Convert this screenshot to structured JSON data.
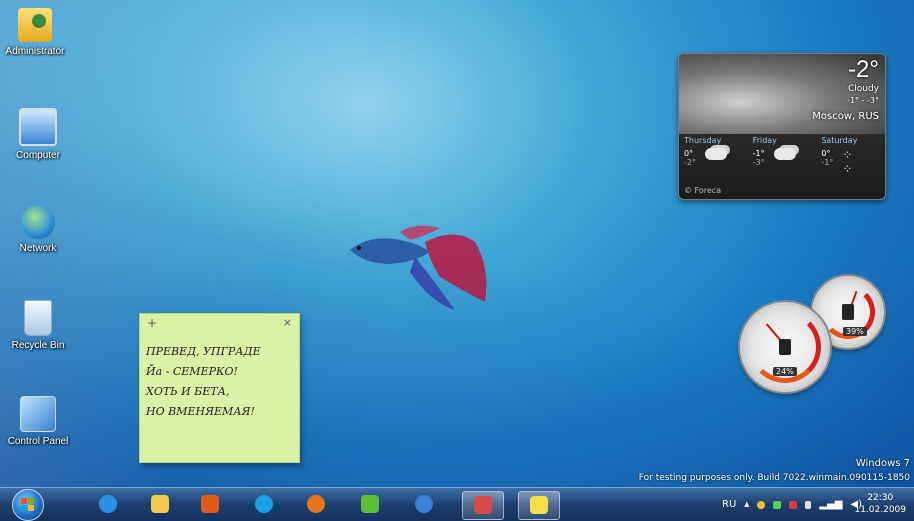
{
  "desktop": {
    "icons": [
      {
        "label": "Administrator"
      },
      {
        "label": "Computer"
      },
      {
        "label": "Network"
      },
      {
        "label": "Recycle Bin"
      },
      {
        "label": "Control Panel"
      }
    ],
    "watermark": {
      "line1": "Windows 7",
      "line2": "For testing purposes only. Build 7022.winmain.090115-1850"
    }
  },
  "weather": {
    "temp": "-2°",
    "condition": "Cloudy",
    "range": "-1° - -3°",
    "city": "Moscow, RUS",
    "days": [
      {
        "name": "Thursday",
        "hi": "0°",
        "lo": "-2°"
      },
      {
        "name": "Friday",
        "hi": "-1°",
        "lo": "-3°"
      },
      {
        "name": "Saturday",
        "hi": "0°",
        "lo": "-1°"
      }
    ],
    "credit": "© Foreca"
  },
  "note": {
    "add_glyph": "+",
    "close_glyph": "×",
    "lines": [
      "ПРЕВЕД, УПГРАДЕ",
      "Йа - СЕМЕРКО!",
      "ХОТЬ И БЕТА,",
      "НО ВМЕНЯЕМАЯ!"
    ]
  },
  "cpu_meter": {
    "cpu_percent_label": "24%",
    "memory_percent_label": "39%",
    "cpu_value": 24,
    "memory_value": 39
  },
  "taskbar": {
    "language": "RU",
    "clock_time": "22:30",
    "clock_date": "11.02.2009",
    "buttons": [
      {
        "icon": "internet-explorer-icon",
        "color": "#2f8fe0"
      },
      {
        "icon": "windows-explorer-icon",
        "color": "#f2c94c"
      },
      {
        "icon": "media-player-icon",
        "color": "#e05a1a"
      },
      {
        "icon": "skype-icon",
        "color": "#1aa0e8"
      },
      {
        "icon": "firefox-icon",
        "color": "#e8751a"
      },
      {
        "icon": "network-app-icon",
        "color": "#5cbf3a"
      },
      {
        "icon": "messenger-icon",
        "color": "#3a7fd8"
      },
      {
        "icon": "paint-icon",
        "color": "#d84a4a"
      },
      {
        "icon": "sticky-notes-icon",
        "color": "#f4e04a"
      }
    ],
    "tray_icons": [
      "show-hidden-icon",
      "security-icon",
      "update-icon",
      "network-error-icon",
      "battery-icon",
      "signal-icon",
      "volume-icon"
    ]
  }
}
